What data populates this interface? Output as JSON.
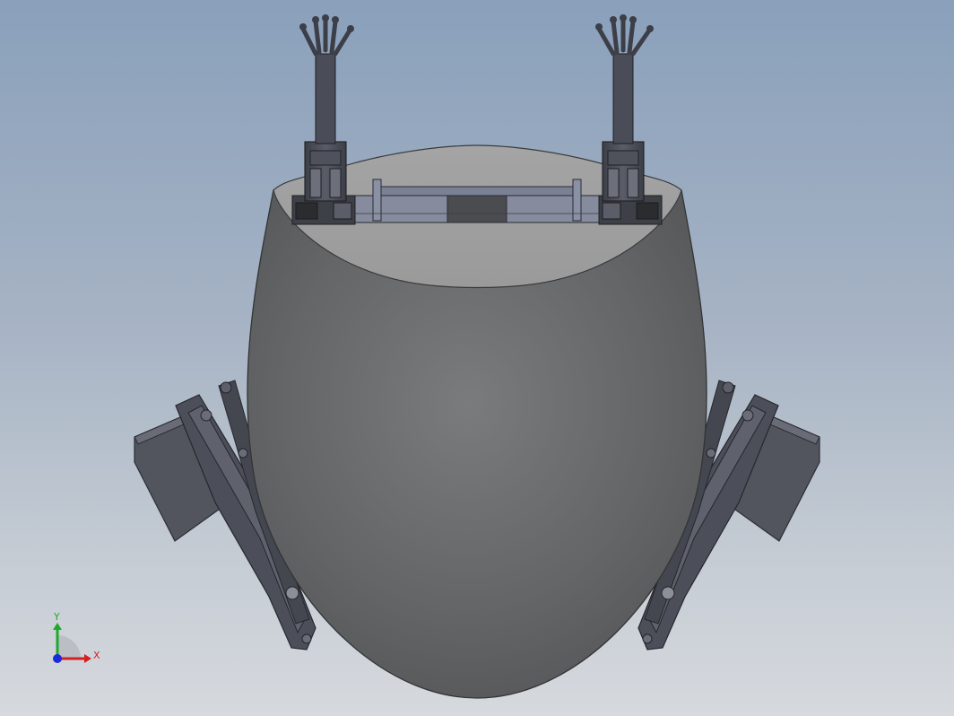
{
  "viewport": {
    "background_top": "#8aa0bb",
    "background_bottom": "#d6d9de",
    "part_color": "#6b6d70",
    "mechanism_color": "#4a4d57"
  },
  "triad": {
    "x_label": "X",
    "y_label": "Y",
    "x_color": "#d42020",
    "y_color": "#1faa2a",
    "z_color": "#1a2bd8"
  }
}
